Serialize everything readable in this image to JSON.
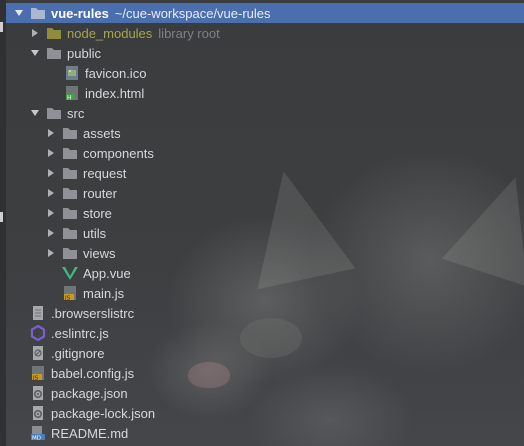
{
  "project": {
    "name": "vue-rules",
    "path": "~/cue-workspace/vue-rules"
  },
  "node_modules": {
    "name": "node_modules",
    "note": "library root"
  },
  "public": {
    "name": "public",
    "files": [
      "favicon.ico",
      "index.html"
    ]
  },
  "src": {
    "name": "src",
    "folders": [
      "assets",
      "components",
      "request",
      "router",
      "store",
      "utils",
      "views"
    ],
    "files": [
      "App.vue",
      "main.js"
    ]
  },
  "root_files": [
    ".browserslistrc",
    ".eslintrc.js",
    ".gitignore",
    "babel.config.js",
    "package.json",
    "package-lock.json",
    "README.md"
  ],
  "colors": {
    "selection": "#4b6eaf",
    "folder": "#8e9296",
    "library_folder": "#a8a64d",
    "vue": "#41b883",
    "js_badge": "#c49a1f"
  }
}
